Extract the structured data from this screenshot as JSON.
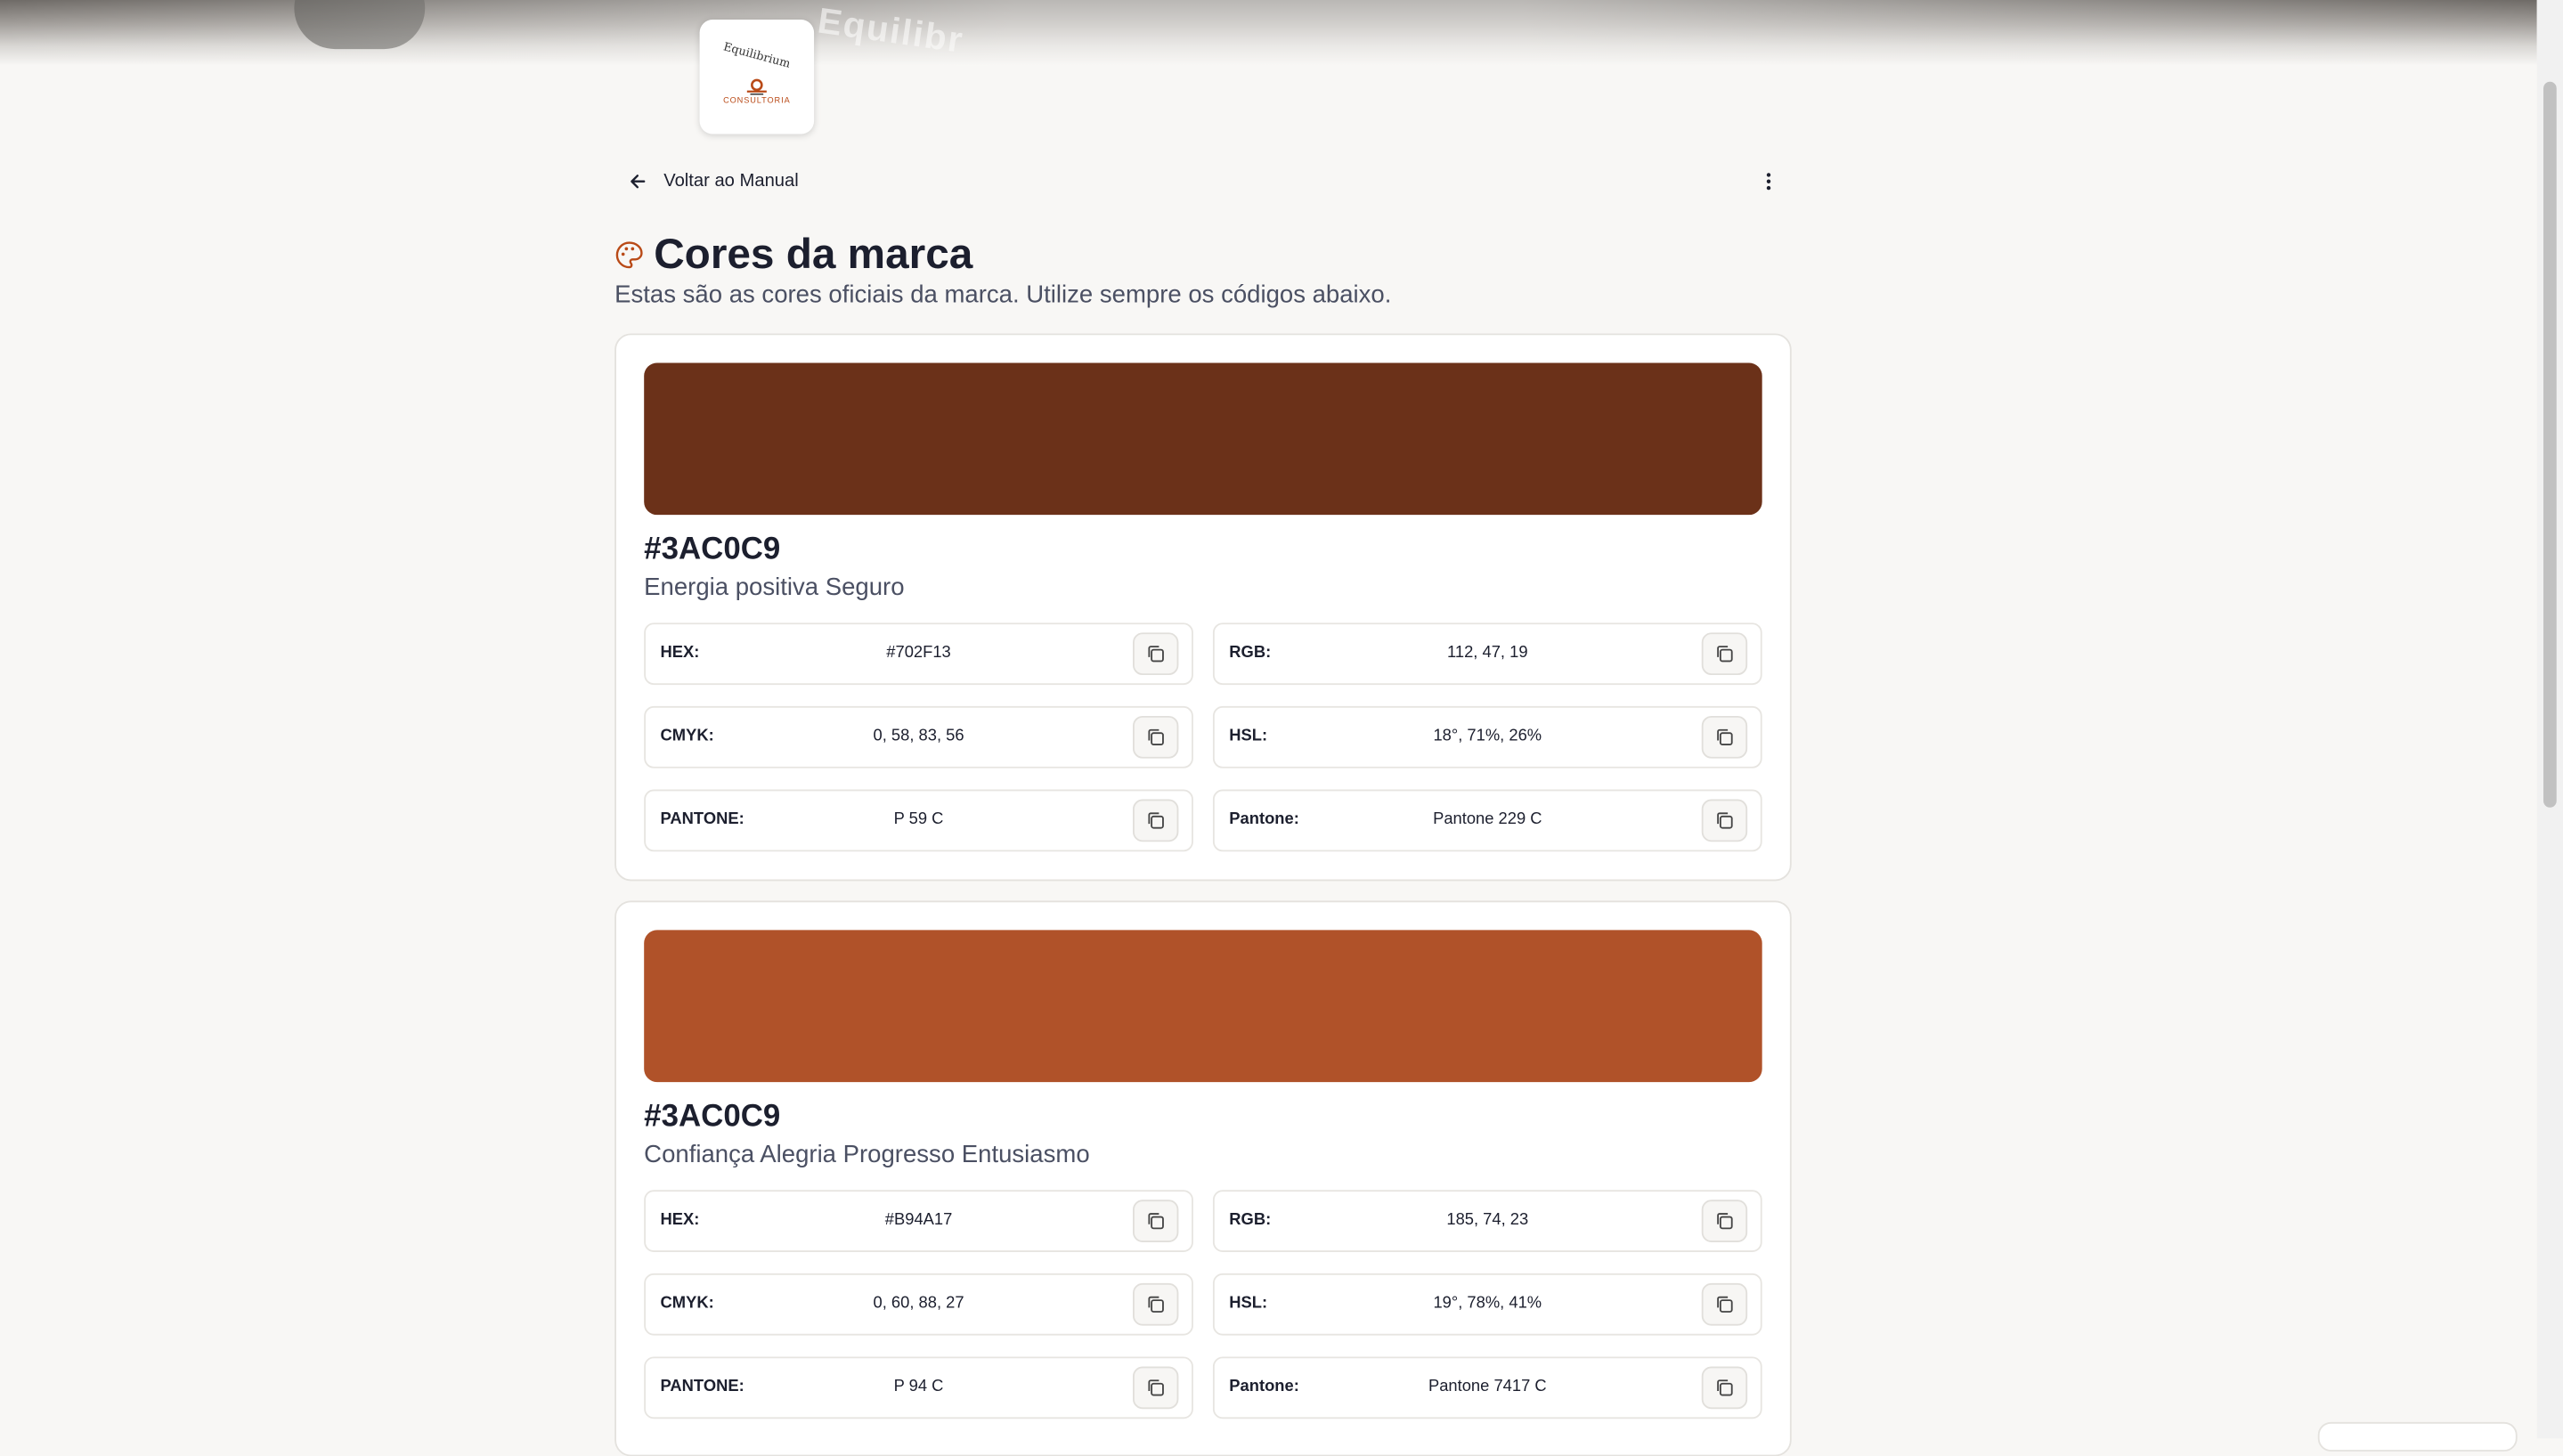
{
  "banner": {
    "word": "Equilibr"
  },
  "logo": {
    "top_text": "Equilibrium",
    "bottom_text": "CONSULTORIA"
  },
  "nav": {
    "back_label": "Voltar ao Manual"
  },
  "header": {
    "title": "Cores da marca",
    "subtitle": "Estas são as cores oficiais da marca. Utilize sempre os códigos abaixo."
  },
  "colors": [
    {
      "swatch": "#6B3119",
      "name": "#3AC0C9",
      "description": "Energia positiva Seguro",
      "fields": {
        "hex": {
          "label": "HEX:",
          "value": "#702F13"
        },
        "rgb": {
          "label": "RGB:",
          "value": "112, 47, 19"
        },
        "cmyk": {
          "label": "CMYK:",
          "value": "0, 58, 83, 56"
        },
        "hsl": {
          "label": "HSL:",
          "value": "18°, 71%, 26%"
        },
        "pantone_code": {
          "label": "PANTONE:",
          "value": "P 59 C"
        },
        "pantone_name": {
          "label": "Pantone:",
          "value": "Pantone 229 C"
        }
      }
    },
    {
      "swatch": "#B05229",
      "name": "#3AC0C9",
      "description": "Confiança Alegria Progresso Entusiasmo",
      "fields": {
        "hex": {
          "label": "HEX:",
          "value": "#B94A17"
        },
        "rgb": {
          "label": "RGB:",
          "value": "185, 74, 23"
        },
        "cmyk": {
          "label": "CMYK:",
          "value": "0, 60, 88, 27"
        },
        "hsl": {
          "label": "HSL:",
          "value": "19°, 78%, 41%"
        },
        "pantone_code": {
          "label": "PANTONE:",
          "value": "P 94 C"
        },
        "pantone_name": {
          "label": "Pantone:",
          "value": "Pantone 7417 C"
        }
      }
    }
  ],
  "accent": "#B94A17"
}
